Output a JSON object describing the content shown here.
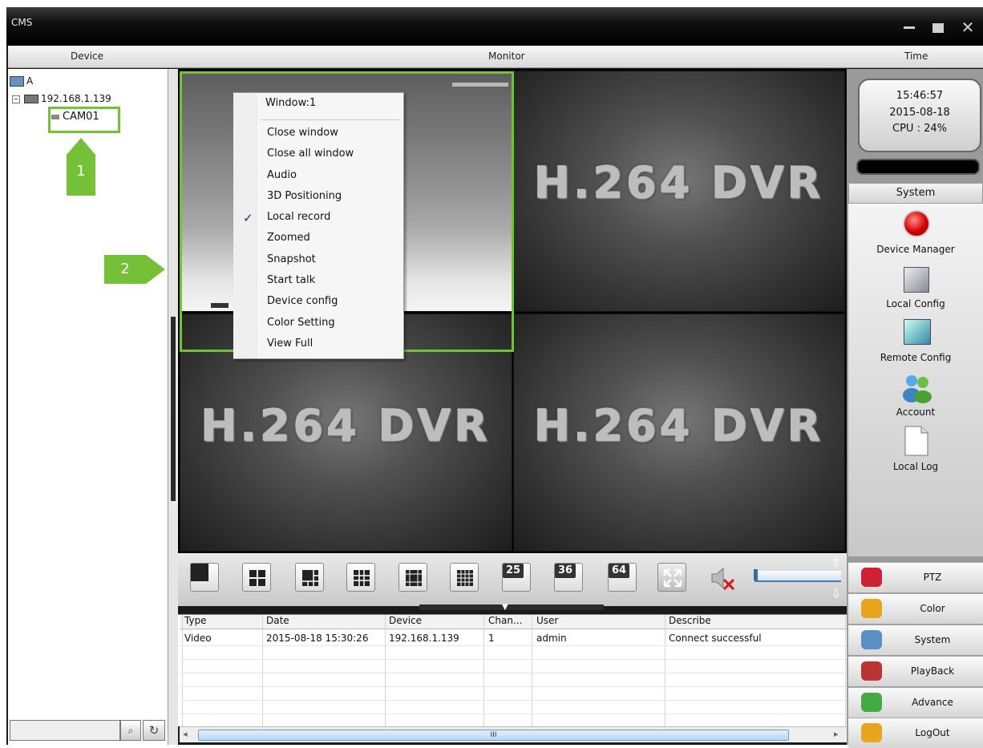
{
  "window": {
    "title": "CMS"
  },
  "header": {
    "device": "Device",
    "monitor": "Monitor",
    "time": "Time"
  },
  "tree": {
    "root": "A",
    "ip": "192.168.1.139",
    "camera": "CAM01"
  },
  "annotations": {
    "marker1": "1",
    "marker2": "2"
  },
  "monitor": {
    "cell_overlay": "H.264 DVR"
  },
  "context_menu": {
    "title": "Window:1",
    "items": [
      "Close window",
      "Close all window",
      "Audio",
      "3D Positioning",
      "Local record",
      "Zoomed",
      "Snapshot",
      "Start talk",
      "Device config",
      "Color Setting",
      "View Full"
    ],
    "checked_item": "Local record",
    "check_glyph": "✓"
  },
  "toolbar": {
    "layouts": [
      "25",
      "36",
      "64"
    ]
  },
  "log": {
    "columns": [
      "Type",
      "Date",
      "Device",
      "Chan...",
      "User",
      "Describe"
    ],
    "rows": [
      [
        "Video",
        "2015-08-18 15:30:26",
        "192.168.1.139",
        "1",
        "admin",
        "Connect successful"
      ]
    ],
    "scroll_thumb": "III"
  },
  "clock": {
    "time": "15:46:57",
    "date": "2015-08-18",
    "cpu": "CPU : 24%"
  },
  "system": {
    "header": "System",
    "items": [
      "Device Manager",
      "Local Config",
      "Remote Config",
      "Account",
      "Local Log"
    ]
  },
  "right_buttons": [
    "PTZ",
    "Color",
    "System",
    "PlayBack",
    "Advance",
    "LogOut"
  ]
}
